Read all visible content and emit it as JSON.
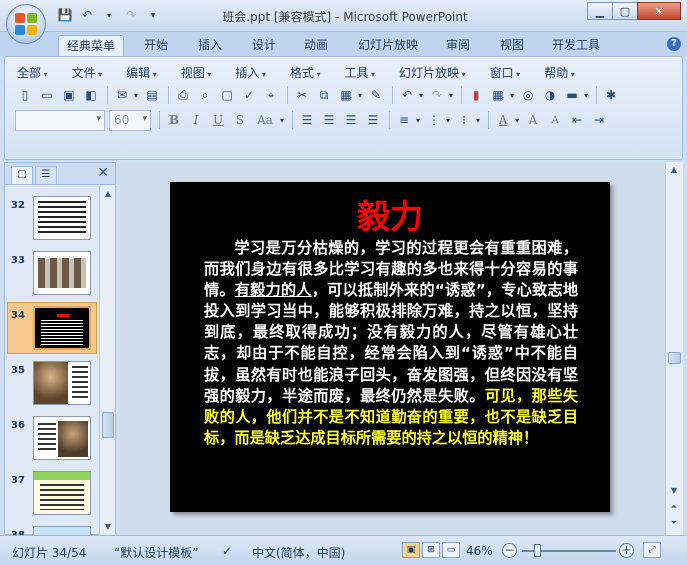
{
  "window": {
    "title": "班会.ppt [兼容模式] - Microsoft PowerPoint",
    "controls": [
      "minimize",
      "maximize",
      "close"
    ]
  },
  "ribbon_tabs": [
    "经典菜单",
    "开始",
    "插入",
    "设计",
    "动画",
    "幻灯片放映",
    "审阅",
    "视图",
    "开发工具"
  ],
  "active_tab": "经典菜单",
  "classic_menus": [
    "全部",
    "文件",
    "编辑",
    "视图",
    "插入",
    "格式",
    "工具",
    "幻灯片放映",
    "窗口",
    "帮助"
  ],
  "format": {
    "font_name": "",
    "font_size": "60"
  },
  "thumbnails": [
    {
      "num": "32"
    },
    {
      "num": "33"
    },
    {
      "num": "34",
      "selected": true
    },
    {
      "num": "35"
    },
    {
      "num": "36"
    },
    {
      "num": "37"
    },
    {
      "num": "38"
    }
  ],
  "slide": {
    "title": "毅力",
    "body_part1": "学习是万分枯燥的，学习的过程更会有重重困难，而我们身边有很多比学习有趣的多也来得十分容易的事情。",
    "body_underlined": "有毅力的人",
    "body_part2": "，可以抵制外来的“诱惑”，专心致志地投入到学习当中，能够积极排除万难，持之以恒，坚持到底，最终取得成功；没有毅力的人，尽管有雄心壮志，却由于不能自控，经常会陷入到“诱惑”中不能自拔，虽然有时也能浪子回头，奋发图强，但终因没有坚强的毅力，半途而废，最终仍然是失败。",
    "body_highlight": "可见，那些失败的人，他们并不是不知道勤奋的重要，也不是缺乏目标，而是缺乏达成目标所需要的持之以恒的精神！",
    "background_color": "#000000",
    "title_color": "#ff0000",
    "highlight_color": "#ffff33"
  },
  "status": {
    "slide_counter": "幻灯片 34/54",
    "template": "“默认设计模板”",
    "language": "中文(简体，中国)",
    "zoom": "46%"
  }
}
